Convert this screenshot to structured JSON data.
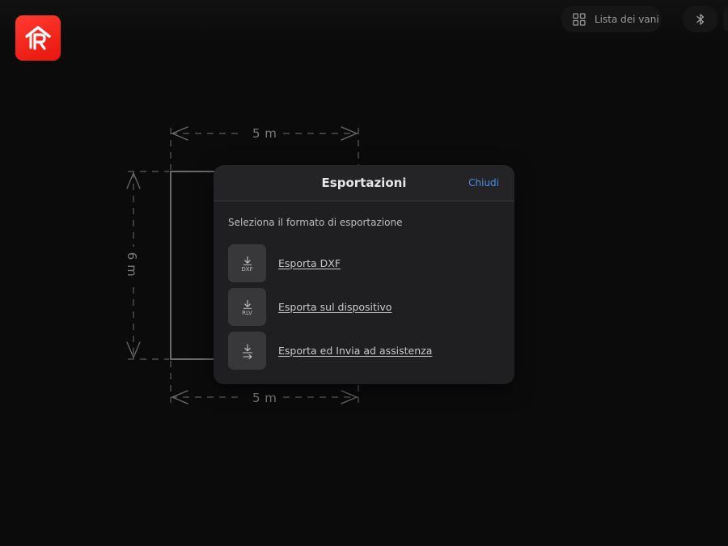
{
  "header": {
    "rooms_button_label": "Lista dei vani"
  },
  "plan": {
    "top_dimension": "5 m",
    "bottom_dimension": "5 m",
    "side_dimension": "6 m"
  },
  "modal": {
    "title": "Esportazioni",
    "close_label": "Chiudi",
    "subtitle": "Seleziona il formato di esportazione",
    "items": [
      {
        "label": "Esporta DXF",
        "icon_caption": "DXF",
        "icon": "download-dxf-icon"
      },
      {
        "label": "Esporta sul dispositivo",
        "icon_caption": "RLV",
        "icon": "download-rlv-icon"
      },
      {
        "label": "Esporta ed Invia ad assistenza",
        "icon_caption": "",
        "icon": "download-send-icon"
      }
    ]
  },
  "colors": {
    "background": "#0b0b0b",
    "modal_background": "#1f1f21",
    "accent_link": "#4a90e2",
    "logo_red": "#ff2a1f"
  }
}
